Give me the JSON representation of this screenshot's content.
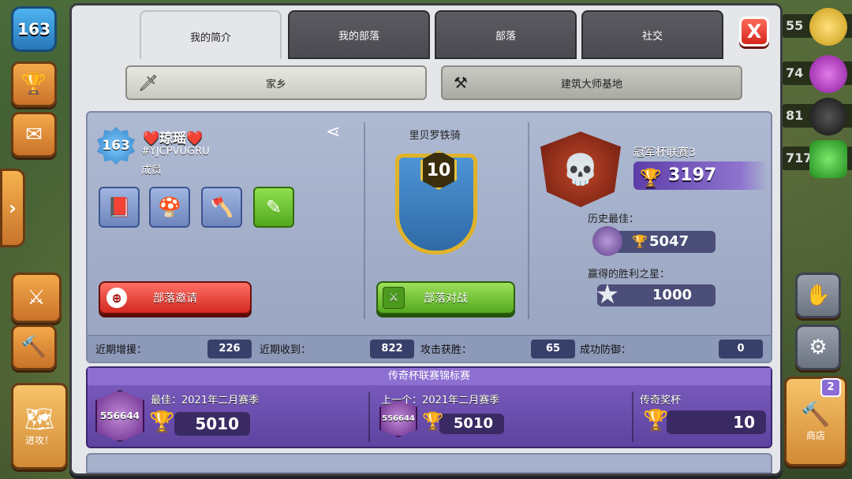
{
  "hud": {
    "level": "163",
    "side_arrow": "›",
    "resources": [
      "55",
      "74",
      "81",
      "717"
    ],
    "notif_count": "2",
    "shop_label": "商店",
    "attack_label": "进攻！"
  },
  "tabs": [
    "我的简介",
    "我的部落",
    "部落",
    "社交"
  ],
  "close_label": "X",
  "villages": {
    "home": "家乡",
    "builder": "建筑大师基地"
  },
  "profile": {
    "level": "163",
    "name": "❤️琼瑶❤️",
    "tag": "#YJCPVUGRU",
    "role": "成员",
    "invite_label": "部落邀请"
  },
  "clan": {
    "name": "里贝罗铁骑",
    "level": "10",
    "war_label": "部落对战"
  },
  "league": {
    "name": "冠军杯联赛3",
    "trophies": "3197",
    "best_label": "历史最佳：",
    "best_trophies": "5047",
    "stars_label": "赢得的胜利之星：",
    "stars": "1000"
  },
  "stats": [
    {
      "label": "近期增援：",
      "value": "226"
    },
    {
      "label": "近期收到：",
      "value": "822"
    },
    {
      "label": "攻击获胜：",
      "value": "65"
    },
    {
      "label": "成功防御：",
      "value": "0"
    }
  ],
  "legend": {
    "title": "传奇杯联赛锦标赛",
    "best": {
      "rank": "556644",
      "label": "最佳：2021年二月赛季",
      "trophies": "5010"
    },
    "previous": {
      "rank": "556644",
      "label": "上一个：2021年二月赛季",
      "trophies": "5010"
    },
    "legend_trophies": {
      "label": "传奇奖杯",
      "value": "10"
    }
  },
  "colors": {
    "panel": "#e4e6ea",
    "tab_inactive": "#4a4b51",
    "card_blue": "#aeb9d2",
    "legend_purple": "#6a4cb0",
    "close_red": "#d4261b",
    "button_green": "#54a91f",
    "trophy_gold": "#f3c623"
  }
}
